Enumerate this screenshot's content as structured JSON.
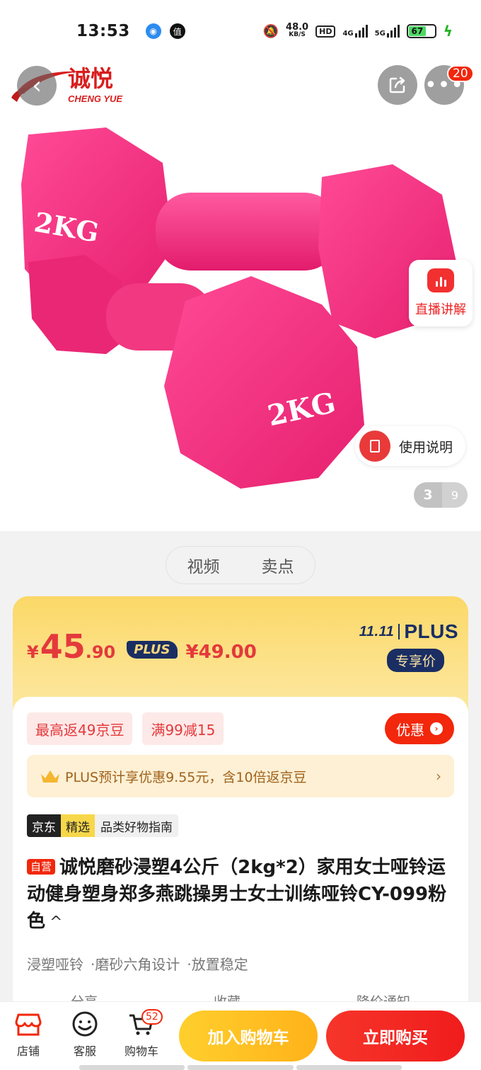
{
  "status_bar": {
    "time": "13:53",
    "net_speed": "48.0",
    "net_unit": "KB/S",
    "hd": "HD",
    "net1": "4G",
    "net2": "5G",
    "battery": "67"
  },
  "header": {
    "brand_name": "诚悦",
    "brand_en": "CHENG YUE",
    "more_badge": "20"
  },
  "hero": {
    "product_label_1": "2KG",
    "product_label_2": "2KG",
    "live_label": "直播讲解",
    "manual_label": "使用说明",
    "page_current": "3",
    "page_total": "9",
    "product_color": "#f5317f"
  },
  "media_tabs": [
    "视频",
    "卖点"
  ],
  "price": {
    "yen": "¥",
    "int": "45",
    "dec": ".90",
    "plus_badge": "PLUS",
    "original": "¥49.00",
    "promo_11": "11.11",
    "promo_plus": "PLUS",
    "exclusive": "专享价"
  },
  "coupons": [
    "最高返49京豆",
    "满99减15"
  ],
  "discount_btn": "优惠",
  "plus_bar": {
    "text": "PLUS预计享优惠9.55元，含10倍返京豆",
    "arrow": "›"
  },
  "rank": {
    "jd": "京东",
    "selected": "精选",
    "text": "品类好物指南"
  },
  "product": {
    "self_tag": "自营",
    "title": "诚悦磨砂浸塑4公斤（2kg*2）家用女士哑铃运动健身塑身郑多燕跳操男士女士训练哑铃CY-099粉色",
    "collapse": "^",
    "features": [
      "浸塑哑铃",
      "·磨砂六角设计",
      "·放置稳定"
    ]
  },
  "actions": [
    "分享",
    "收藏",
    "降价通知"
  ],
  "bottom_bar": {
    "shop": "店铺",
    "service": "客服",
    "cart": "购物车",
    "cart_count": "52",
    "add_to_cart": "加入购物车",
    "buy_now": "立即购买"
  },
  "colors": {
    "accent_red": "#f2270c",
    "plus_navy": "#1a2e63",
    "cart_yellow": "#ffbf21"
  }
}
